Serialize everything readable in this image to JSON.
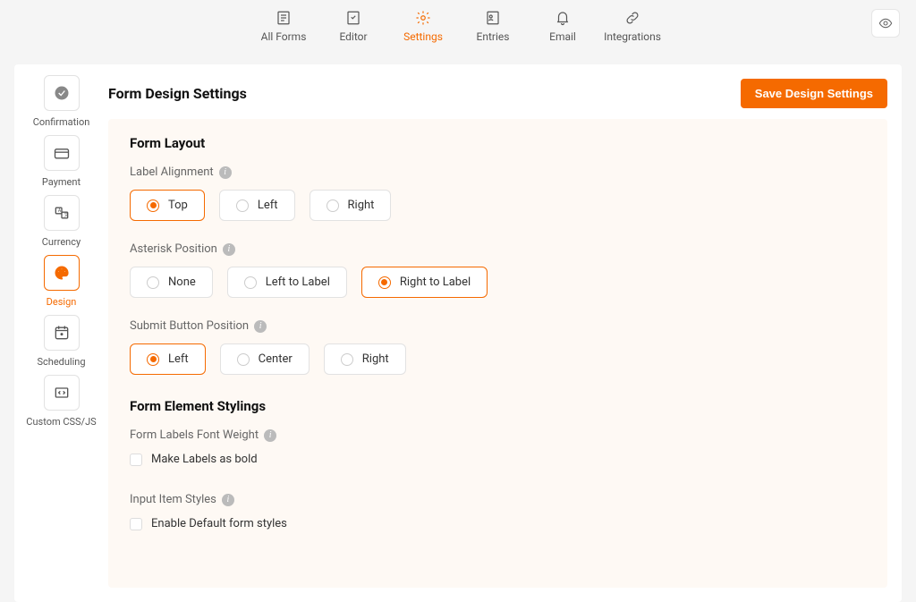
{
  "topnav": {
    "items": [
      {
        "label": "All Forms",
        "icon": "forms"
      },
      {
        "label": "Editor",
        "icon": "editor"
      },
      {
        "label": "Settings",
        "icon": "gear",
        "active": true
      },
      {
        "label": "Entries",
        "icon": "entries"
      },
      {
        "label": "Email",
        "icon": "bell"
      },
      {
        "label": "Integrations",
        "icon": "link"
      }
    ]
  },
  "sidebar": {
    "items": [
      {
        "label": "Confirmation",
        "icon": "check-circle"
      },
      {
        "label": "Payment",
        "icon": "card"
      },
      {
        "label": "Currency",
        "icon": "currency"
      },
      {
        "label": "Design",
        "icon": "palette",
        "active": true
      },
      {
        "label": "Scheduling",
        "icon": "calendar"
      },
      {
        "label": "Custom CSS/JS",
        "icon": "code"
      }
    ]
  },
  "page_title": "Form Design Settings",
  "save_button": "Save Design Settings",
  "sections": {
    "layout_title": "Form Layout",
    "stylings_title": "Form Element Stylings"
  },
  "fields": {
    "label_alignment": {
      "label": "Label Alignment",
      "options": [
        "Top",
        "Left",
        "Right"
      ],
      "selected": "Top"
    },
    "asterisk_position": {
      "label": "Asterisk Position",
      "options": [
        "None",
        "Left to Label",
        "Right to Label"
      ],
      "selected": "Right to Label"
    },
    "submit_button_position": {
      "label": "Submit Button Position",
      "options": [
        "Left",
        "Center",
        "Right"
      ],
      "selected": "Left"
    },
    "font_weight": {
      "label": "Form Labels Font Weight",
      "checkbox_label": "Make Labels as bold",
      "checked": false
    },
    "input_styles": {
      "label": "Input Item Styles",
      "checkbox_label": "Enable Default form styles",
      "checked": false
    }
  }
}
